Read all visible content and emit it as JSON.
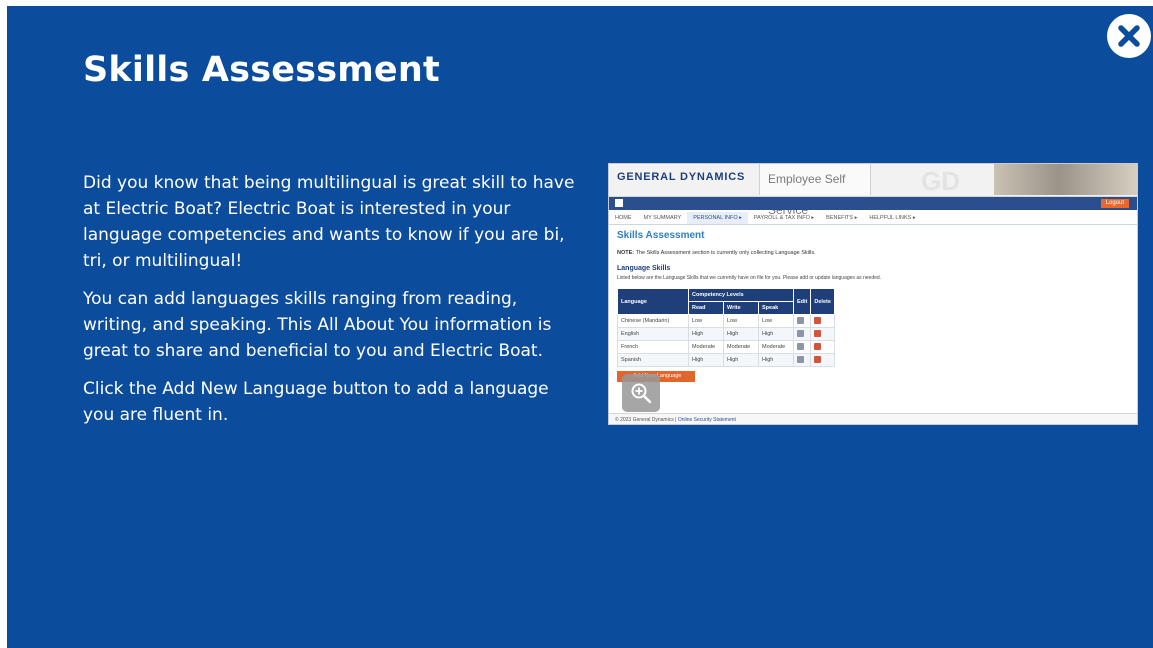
{
  "slide": {
    "title": "Skills Assessment",
    "paragraphs": [
      "Did you know that being multilingual is great skill to have at Electric Boat? Electric Boat is interested in your language competencies and wants to know if you are bi, tri, or multilingual!",
      "You can add languages skills ranging from reading, writing, and speaking. This All About You information is great to share and beneficial to you and Electric Boat.",
      "Click the Add New Language button to add a language you are fluent in."
    ],
    "close_icon": "close-icon",
    "colors": {
      "background": "#0b4c9c",
      "text": "#ffffff"
    }
  },
  "screenshot": {
    "logo": "GENERAL DYNAMICS",
    "app_title": "Employee Self Service",
    "logo_mark": "GD",
    "logout": "Logout",
    "tabs": [
      "HOME",
      "MY SUMMARY",
      "PERSONAL INFO ▸",
      "PAYROLL & TAX INFO ▸",
      "BENEFITS ▸",
      "HELPFUL LINKS ▸"
    ],
    "page_title": "Skills Assessment",
    "note_label": "NOTE:",
    "note_text": "The Skills Assessment section is currently only collecting Language Skills.",
    "section_title": "Language Skills",
    "section_desc": "Listed below are the Language Skills that we currently have on file for you. Please add or update languages as needed.",
    "table": {
      "h_language": "Language",
      "h_competency": "Competency Levels",
      "h_edit": "Edit",
      "h_delete": "Delete",
      "h_read": "Read",
      "h_write": "Write",
      "h_speak": "Speak",
      "rows": [
        [
          "Chinese (Mandarin)",
          "Low",
          "Low",
          "Low"
        ],
        [
          "English",
          "High",
          "High",
          "High"
        ],
        [
          "French",
          "Moderate",
          "Moderate",
          "Moderate"
        ],
        [
          "Spanish",
          "High",
          "High",
          "High"
        ]
      ]
    },
    "add_button": "Add New Language",
    "zoom_icon": "zoom-in-icon",
    "footer_copy": "© 2023 General Dynamics",
    "footer_link": "Online Security Statement"
  }
}
